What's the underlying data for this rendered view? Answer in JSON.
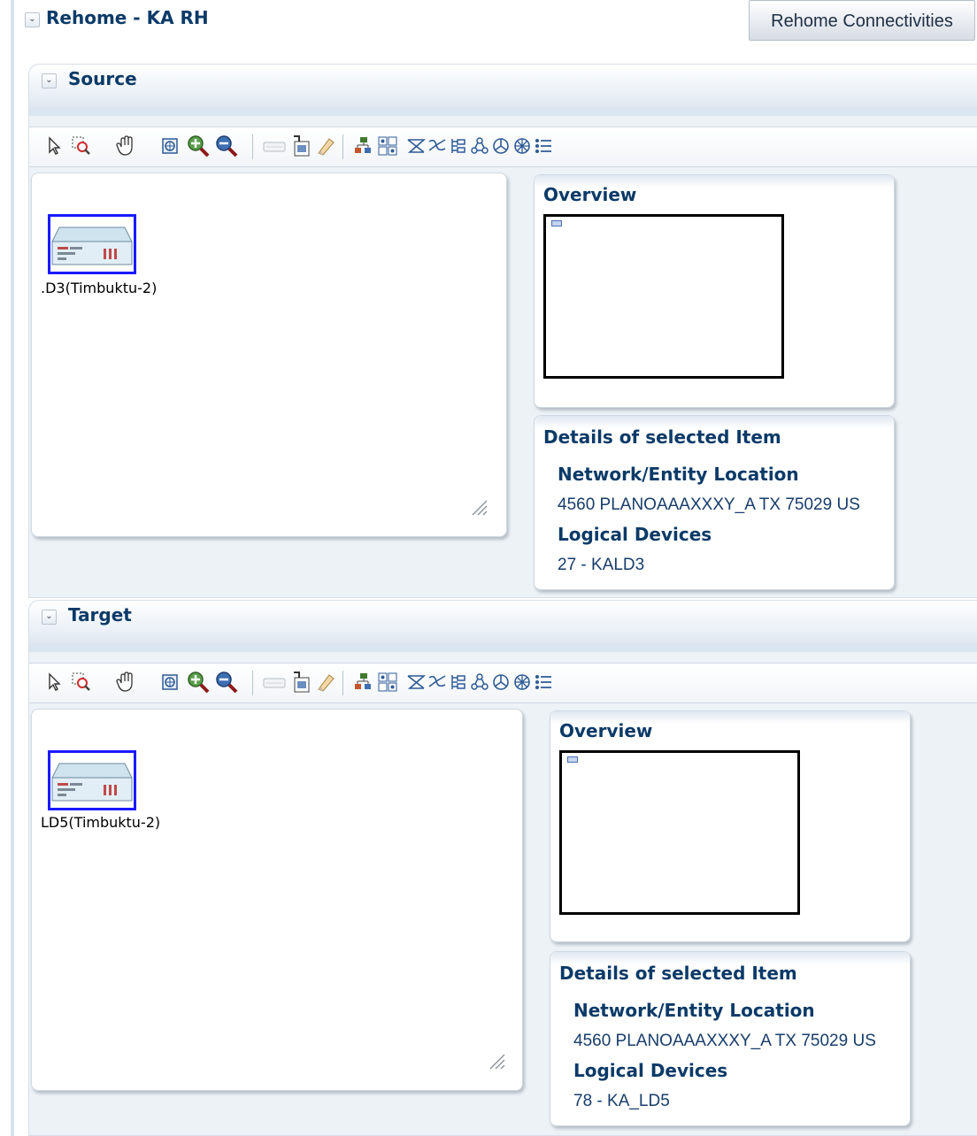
{
  "header": {
    "title": "Rehome - KA RH",
    "rehome_button": "Rehome Connectivities"
  },
  "source": {
    "section_title": "Source",
    "device_label": ".D3(Timbuktu-2)",
    "overview_title": "Overview",
    "details_title": "Details of selected Item",
    "network_location_label": "Network/Entity Location",
    "network_location_value": "4560 PLANOAAAXXXY_A TX 75029 US",
    "logical_devices_label": "Logical Devices",
    "logical_devices_value": "27 - KALD3"
  },
  "target": {
    "section_title": "Target",
    "device_label": "LD5(Timbuktu-2)",
    "overview_title": "Overview",
    "details_title": "Details of selected Item",
    "network_location_label": "Network/Entity Location",
    "network_location_value": "4560 PLANOAAAXXXY_A TX 75029 US",
    "logical_devices_label": "Logical Devices",
    "logical_devices_value": "78 - KA_LD5"
  },
  "toolbar_icons": [
    "select-arrow-icon",
    "marquee-zoom-icon",
    "pan-hand-icon",
    "zoom-fit-icon",
    "zoom-in-icon",
    "zoom-out-icon",
    "overview-toggle-icon",
    "export-image-icon",
    "clear-icon",
    "hierarchical-layout-icon",
    "grid-layout-icon",
    "layout-a-icon",
    "layout-b-icon",
    "layout-c-icon",
    "layout-d-icon",
    "layout-e-icon",
    "layout-f-icon",
    "layout-g-icon"
  ],
  "colors": {
    "title_text": "#0b3a68",
    "node_border": "#1a1aff",
    "panel_bg": "#edf2f7"
  }
}
